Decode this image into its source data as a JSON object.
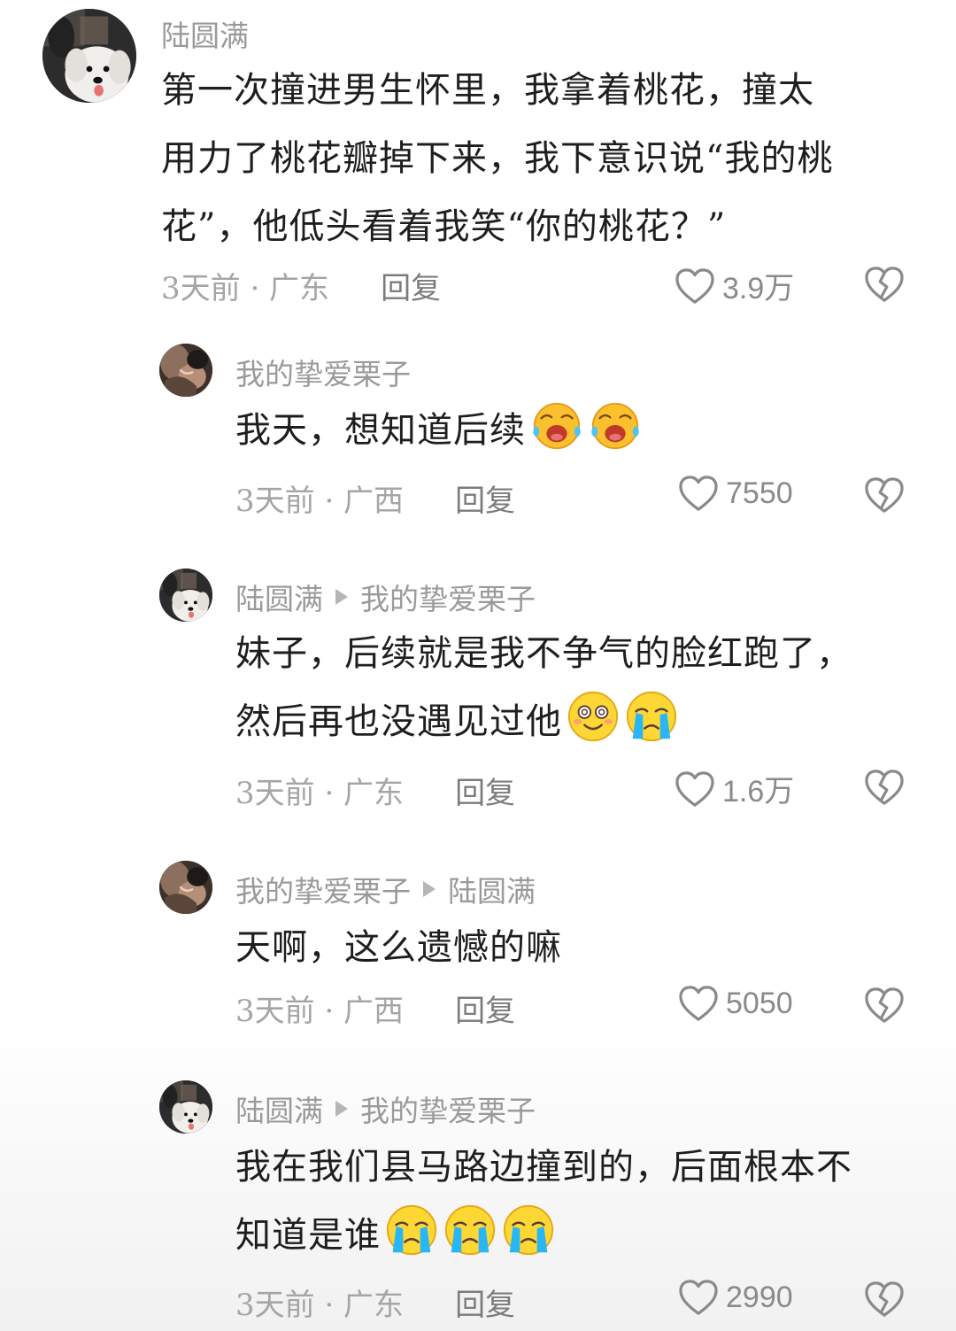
{
  "comments": [
    {
      "user": "陆圆满",
      "reply_to": "",
      "lines": [
        "第一次撞进男生怀里，我拿着桃花，撞太",
        "用力了桃花瓣掉下来，我下意识说“我的桃",
        "花”，他低头看着我笑“你的桃花？”"
      ],
      "time_location": "3天前 · 广东",
      "reply_label": "回复",
      "likes": "3.9万",
      "avatar": "white-dog-avatar"
    },
    {
      "user": "我的挚爱栗子",
      "reply_to": "",
      "lines": [
        "我天，想知道后续"
      ],
      "emojis": [
        "crying-face-emoji",
        "crying-face-emoji"
      ],
      "time_location": "3天前 · 广西",
      "reply_label": "回复",
      "likes": "7550",
      "avatar": "dark-photo-avatar"
    },
    {
      "user": "陆圆满",
      "reply_to": "我的挚爱栗子",
      "lines": [
        "妹子，后续就是我不争气的脸红跑了，",
        "然后再也没遇见过他"
      ],
      "emojis": [
        "dizzy-smile-emoji",
        "tearful-face-emoji"
      ],
      "time_location": "3天前 · 广东",
      "reply_label": "回复",
      "likes": "1.6万",
      "avatar": "white-dog-avatar"
    },
    {
      "user": "我的挚爱栗子",
      "reply_to": "陆圆满",
      "lines": [
        "天啊，这么遗憾的嘛"
      ],
      "time_location": "3天前 · 广西",
      "reply_label": "回复",
      "likes": "5050",
      "avatar": "dark-photo-avatar"
    },
    {
      "user": "陆圆满",
      "reply_to": "我的挚爱栗子",
      "lines": [
        "我在我们县马路边撞到的，后面根本不",
        "知道是谁"
      ],
      "emojis": [
        "tearful-face-emoji",
        "tearful-face-emoji",
        "tearful-face-emoji"
      ],
      "time_location": "3天前 · 广东",
      "reply_label": "回复",
      "likes": "2990",
      "avatar": "white-dog-avatar"
    }
  ],
  "colors": {
    "username": "#9a9a9a",
    "meta": "#a5a5a5",
    "text": "#1e1e1e",
    "icon": "#8a8a8a"
  }
}
